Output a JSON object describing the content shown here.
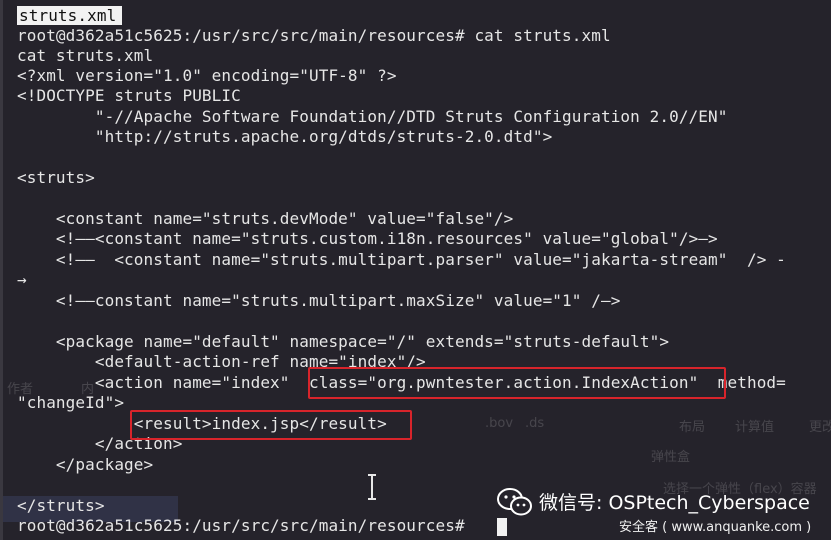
{
  "terminal": {
    "title_selection": "struts.xml",
    "lines": [
      "root@d362a51c5625:/usr/src/src/main/resources# cat struts.xml",
      "cat struts.xml",
      "<?xml version=\"1.0\" encoding=\"UTF-8\" ?>",
      "<!DOCTYPE struts PUBLIC",
      "        \"-//Apache Software Foundation//DTD Struts Configuration 2.0//EN\"",
      "        \"http://struts.apache.org/dtds/struts-2.0.dtd\">",
      "",
      "<struts>",
      "",
      "    <constant name=\"struts.devMode\" value=\"false\"/>",
      "    <!——<constant name=\"struts.custom.i18n.resources\" value=\"global\"/>—>",
      "    <!——  <constant name=\"struts.multipart.parser\" value=\"jakarta-stream\"  /> -",
      "→",
      "    <!——constant name=\"struts.multipart.maxSize\" value=\"1\" /—>",
      "",
      "    <package name=\"default\" namespace=\"/\" extends=\"struts-default\">",
      "        <default-action-ref name=\"index\"/>",
      "        <action name=\"index\"  class=\"org.pwntester.action.IndexAction\"  method=",
      "\"changeId\">",
      "            <result>index.jsp</result>",
      "        </action>",
      "    </package>",
      "",
      "</struts>",
      "root@d362a51c5625:/usr/src/src/main/resources# "
    ]
  },
  "ghost_ui": {
    "left_labels": [
      "作者",
      "内"
    ],
    "right_labels": [
      ".bov",
      ".ds",
      "布局",
      "计算值",
      "更改",
      "弹性盒",
      "选择一个弹性（flex）容器"
    ]
  },
  "watermark": {
    "title": "微信号: OSPtech_Cyberspace",
    "subtitle": "安全客 ( www.anquanke.com )",
    "icon": "wechat-icon"
  },
  "colors": {
    "background": "#25232b",
    "text": "#e6e6e6",
    "highlight_box": "#d8242b",
    "selection": "#f2f2f2"
  }
}
